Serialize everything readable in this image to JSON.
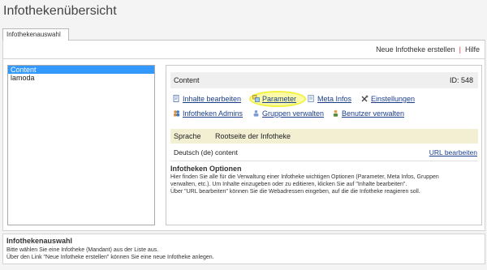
{
  "page": {
    "title": "Infothekenübersicht"
  },
  "tab": {
    "label": "Infothekenauswahl"
  },
  "toolbar": {
    "new_label": "Neue Infotheke erstellen",
    "separator": "|",
    "help_label": "Hilfe"
  },
  "list": {
    "items": [
      "Content",
      "lamoda"
    ],
    "selected_index": 0
  },
  "detail": {
    "name": "Content",
    "id_text": "ID: 548",
    "actions": {
      "inhalte": {
        "label": "Inhalte bearbeiten",
        "icon": "document-edit-icon"
      },
      "parameter": {
        "label": "Parameter",
        "icon": "parameter-icon"
      },
      "meta": {
        "label": "Meta Infos",
        "icon": "meta-info-icon"
      },
      "einstellungen": {
        "label": "Einstellungen",
        "icon": "tools-icon"
      },
      "admins": {
        "label": "Infotheken Admins",
        "icon": "users-icon"
      },
      "gruppen": {
        "label": "Gruppen verwalten",
        "icon": "groups-icon"
      },
      "benutzer": {
        "label": "Benutzer verwalten",
        "icon": "user-icon"
      }
    },
    "lang_header": {
      "sprache": "Sprache",
      "rootseite": "Rootseite der Infotheke"
    },
    "lang_row": {
      "language": "Deutsch (de)",
      "root": "content",
      "edit_url": "URL bearbeiten"
    }
  },
  "options": {
    "title": "Infotheken Optionen",
    "text_line1": "Hier finden Sie alle für die Verwaltung einer Infotheke wichtigen Optionen (Parameter, Meta Infos, Gruppen",
    "text_line2": "verwalten, etc.). Um Inhalte einzugeben oder zu editieren, klicken Sie auf \"Inhalte bearbeiten\".",
    "text_line3": "Über \"URL bearbeiten\" können Sie die Webadressen eingeben, auf die die Infotheke reagieren soll."
  },
  "footer": {
    "title": "Infothekenauswahl",
    "text_line1": "Bitte wählen Sie eine Infotheke (Mandant) aus der Liste aus.",
    "text_line2": "Über den Link \"Neue Infotheke erstellen\" können Sie eine neue Infotheke anlegen."
  },
  "colors": {
    "link": "#1a3e8c",
    "selection": "#3399ff",
    "lang_header_bg": "#f2efd3",
    "highlight": "#f6f660",
    "separator": "#c43c3c"
  }
}
